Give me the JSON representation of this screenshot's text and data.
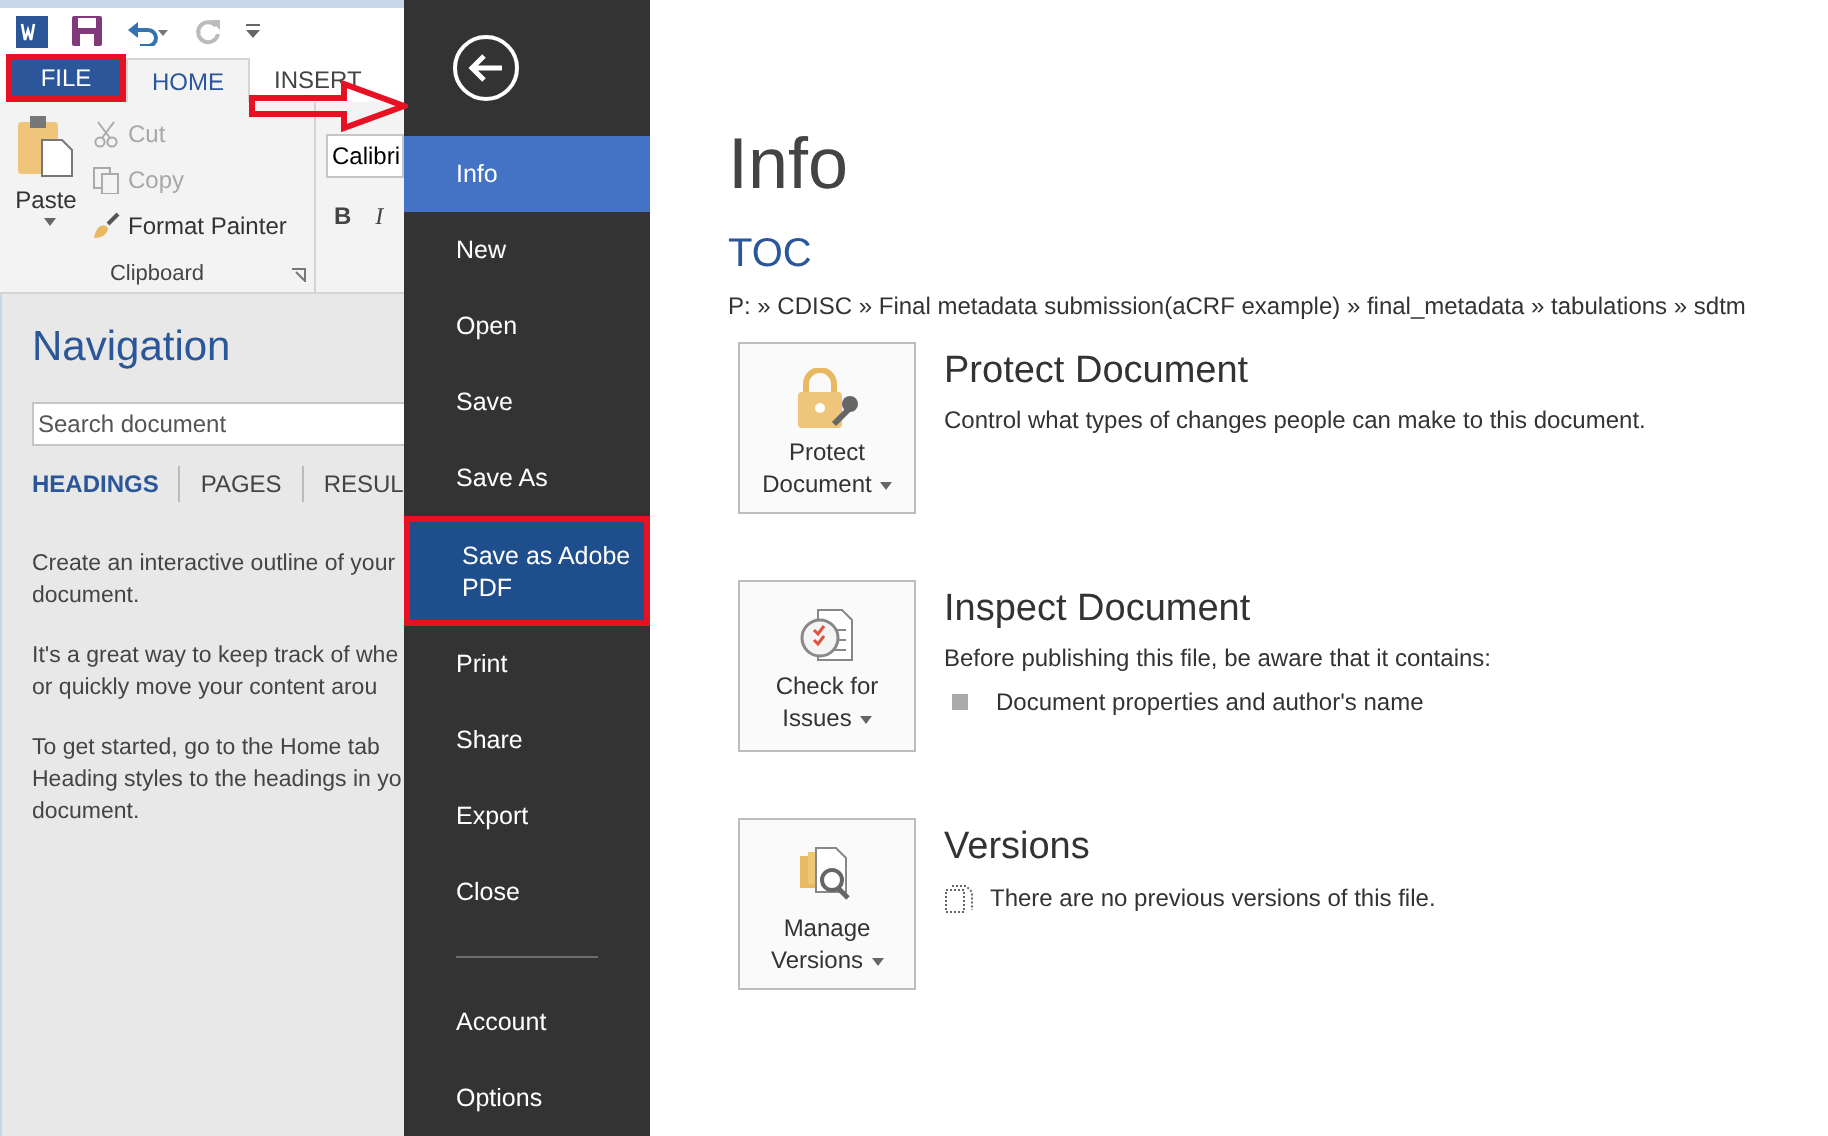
{
  "quick_access": {
    "redo_disabled": true
  },
  "ribbon_tabs": [
    {
      "label": "FILE",
      "kind": "file",
      "selected": false,
      "annotated": true
    },
    {
      "label": "HOME",
      "kind": "tab",
      "selected": true,
      "annotated": false
    },
    {
      "label": "INSERT",
      "kind": "tab",
      "selected": false,
      "annotated": false
    }
  ],
  "clipboard": {
    "paste": "Paste",
    "items": [
      {
        "label": "Cut",
        "kind": "cut",
        "disabled": true
      },
      {
        "label": "Copy",
        "kind": "copy",
        "disabled": true
      },
      {
        "label": "Format Painter",
        "kind": "painter",
        "disabled": false
      }
    ],
    "group_label": "Clipboard"
  },
  "font": {
    "name": "Calibri",
    "bold": "B",
    "italic": "I"
  },
  "navigation": {
    "title": "Navigation",
    "search_placeholder": "Search document",
    "tabs": [
      {
        "label": "HEADINGS",
        "selected": true
      },
      {
        "label": "PAGES",
        "selected": false
      },
      {
        "label": "RESUL",
        "selected": false
      }
    ],
    "paragraphs": [
      [
        "Create an interactive outline of your",
        "document."
      ],
      [
        "It's a great way to keep track of whe",
        "or quickly move your content arou"
      ],
      [
        "To get started, go to the Home tab",
        "Heading styles to the headings in yo",
        "document."
      ]
    ]
  },
  "backstage_menu": [
    {
      "label": "Info",
      "selected": true,
      "annotated": false
    },
    {
      "label": "New",
      "selected": false,
      "annotated": false
    },
    {
      "label": "Open",
      "selected": false,
      "annotated": false
    },
    {
      "label": "Save",
      "selected": false,
      "annotated": false
    },
    {
      "label": "Save As",
      "selected": false,
      "annotated": false
    },
    {
      "label": "Save as Adobe PDF",
      "selected": false,
      "annotated": true
    },
    {
      "label": "Print",
      "selected": false,
      "annotated": false
    },
    {
      "label": "Share",
      "selected": false,
      "annotated": false
    },
    {
      "label": "Export",
      "selected": false,
      "annotated": false
    },
    {
      "label": "Close",
      "selected": false,
      "annotated": false
    }
  ],
  "backstage_bottom": [
    {
      "label": "Account",
      "selected": false
    },
    {
      "label": "Options",
      "selected": false
    }
  ],
  "info": {
    "title": "Info",
    "doc_name": "TOC",
    "path": "P: » CDISC » Final metadata submission(aCRF example) » final_metadata » tabulations » sdtm",
    "sections": [
      {
        "kind": "protect",
        "button": [
          "Protect",
          "Document"
        ],
        "heading": "Protect Document",
        "description": "Control what types of changes people can make to this document."
      },
      {
        "kind": "inspect",
        "button": [
          "Check for",
          "Issues"
        ],
        "heading": "Inspect Document",
        "description": "Before publishing this file, be aware that it contains:",
        "bullets": [
          "Document properties and author's name"
        ]
      },
      {
        "kind": "versions",
        "button": [
          "Manage",
          "Versions"
        ],
        "heading": "Versions",
        "note": "There are no previous versions of this file."
      }
    ]
  }
}
